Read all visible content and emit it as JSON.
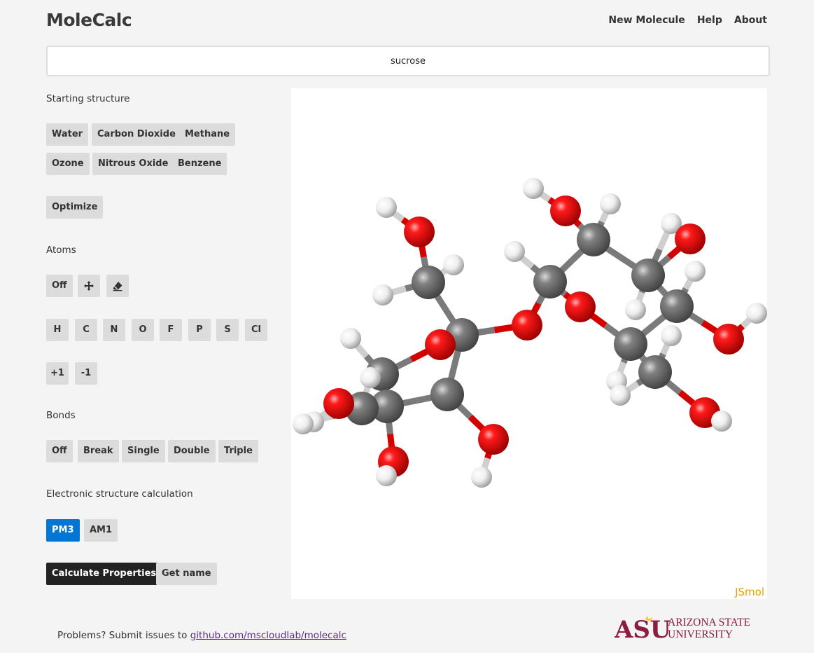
{
  "header": {
    "brand": "MoleCalc",
    "nav": [
      "New Molecule",
      "Help",
      "About"
    ]
  },
  "search": {
    "value": "sucrose"
  },
  "starting_structure": {
    "label": "Starting structure",
    "presets": [
      "Water",
      "Carbon Dioxide",
      "Methane",
      "Ozone",
      "Nitrous Oxide",
      "Benzene"
    ],
    "optimize": "Optimize"
  },
  "atoms": {
    "label": "Atoms",
    "off": "Off",
    "move_icon": "move-icon",
    "erase_icon": "eraser-icon",
    "elements": [
      "H",
      "C",
      "N",
      "O",
      "F",
      "P",
      "S",
      "Cl"
    ],
    "charges": [
      "+1",
      "-1"
    ]
  },
  "bonds": {
    "label": "Bonds",
    "options": [
      "Off",
      "Break",
      "Single",
      "Double",
      "Triple"
    ]
  },
  "electronic": {
    "label": "Electronic structure calculation",
    "methods": [
      "PM3",
      "AM1"
    ],
    "selected": "PM3"
  },
  "actions": {
    "calculate": "Calculate Properties",
    "get_name": "Get name"
  },
  "viewer": {
    "watermark": "JSmol"
  },
  "footer": {
    "text": "Problems? Submit issues to ",
    "link": "github.com/mscloudlab/molecalc",
    "logo_mark": "ASU",
    "logo_line1": "ARIZONA STATE",
    "logo_line2": "UNIVERSITY"
  },
  "colors": {
    "accent": "#0276d4",
    "oxygen": "#e60000",
    "carbon": "#808080",
    "hydrogen": "#f0f0f0",
    "asu_maroon": "#8c1d40",
    "asu_gold": "#ffc627"
  }
}
